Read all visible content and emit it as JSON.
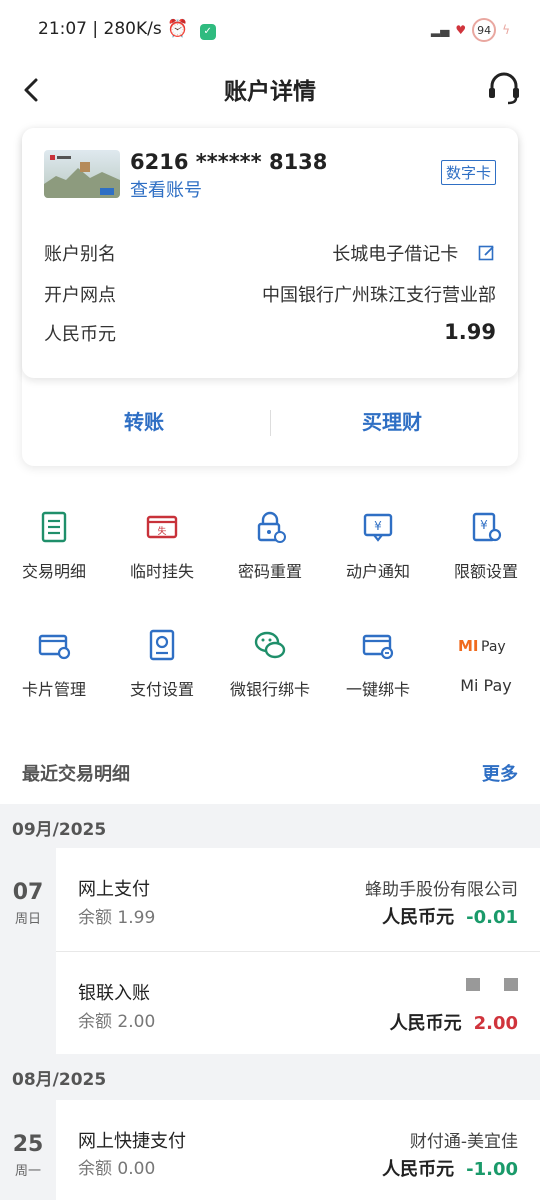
{
  "status_bar": {
    "time": "21:07 | 280K/s",
    "battery": "94"
  },
  "nav": {
    "title": "账户详情"
  },
  "card": {
    "number": "6216 ****** 8138",
    "view_account": "查看账号",
    "badge": "数字卡",
    "rows": [
      {
        "label": "账户别名",
        "value": "长城电子借记卡"
      },
      {
        "label": "开户网点",
        "value": "中国银行广州珠江支行营业部"
      },
      {
        "label": "人民币元",
        "value": "1.99"
      }
    ],
    "actions": {
      "transfer": "转账",
      "wealth": "买理财"
    }
  },
  "grid": [
    {
      "label": "交易明细",
      "icon": "transaction-detail-icon"
    },
    {
      "label": "临时挂失",
      "icon": "report-loss-icon"
    },
    {
      "label": "密码重置",
      "icon": "password-reset-icon"
    },
    {
      "label": "动户通知",
      "icon": "account-notify-icon"
    },
    {
      "label": "限额设置",
      "icon": "limit-settings-icon"
    },
    {
      "label": "卡片管理",
      "icon": "card-manage-icon"
    },
    {
      "label": "支付设置",
      "icon": "payment-settings-icon"
    },
    {
      "label": "微银行绑卡",
      "icon": "wechat-icon"
    },
    {
      "label": "一键绑卡",
      "icon": "one-click-bind-icon"
    },
    {
      "label": "Mi Pay",
      "icon": "mi-pay-icon"
    }
  ],
  "recent": {
    "title": "最近交易明细",
    "more": "更多"
  },
  "months": [
    {
      "label": "09月/2025",
      "days": [
        {
          "day": "07",
          "week": "周日",
          "transactions": [
            {
              "title": "网上支付",
              "balance": "余额 1.99",
              "merchant": "蜂助手股份有限公司",
              "currency": "人民币元",
              "amount": "-0.01"
            },
            {
              "title": "银联入账",
              "balance": "余额 2.00",
              "merchant": "",
              "currency": "人民币元",
              "amount": "2.00"
            }
          ]
        }
      ]
    },
    {
      "label": "08月/2025",
      "days": [
        {
          "day": "25",
          "week": "周一",
          "transactions": [
            {
              "title": "网上快捷支付",
              "balance": "余额 0.00",
              "merchant": "财付通-美宜佳",
              "currency": "人民币元",
              "amount": "-1.00"
            }
          ]
        }
      ]
    }
  ],
  "colors": {
    "accent": "#2f6fc4",
    "negative": "#1a9a6a",
    "positive": "#d0343c",
    "icon_green": "#1f8f6a",
    "icon_red": "#c8323a",
    "mi_orange": "#f06a1d"
  }
}
